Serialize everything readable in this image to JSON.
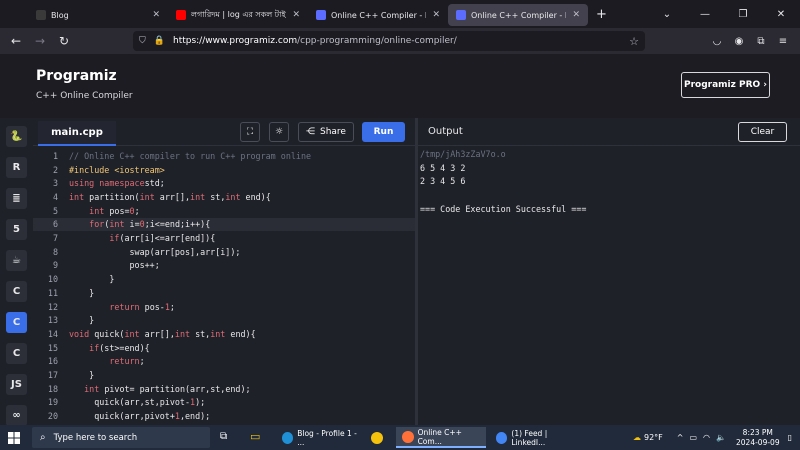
{
  "browser": {
    "tabs": [
      {
        "title": "Blog",
        "active": false,
        "color": "#3a3a3a"
      },
      {
        "title": "লগারিদম | log এর সকল টাইপের",
        "active": false,
        "color": "#ff0000"
      },
      {
        "title": "Online C++ Compiler - Program",
        "active": false,
        "color": "#5b6cff"
      },
      {
        "title": "Online C++ Compiler - Program",
        "active": true,
        "color": "#5b6cff"
      }
    ],
    "new_tab": "+",
    "url_host": "https://www.programiz.com",
    "url_path": "/cpp-programming/online-compiler/"
  },
  "site": {
    "logo": "Programiz",
    "subtitle": "C++ Online Compiler",
    "pro_button": "Programiz PRO ›"
  },
  "rail": {
    "items": [
      {
        "name": "python",
        "glyph": "🐍"
      },
      {
        "name": "r",
        "glyph": "R"
      },
      {
        "name": "sql",
        "glyph": "≣"
      },
      {
        "name": "html",
        "glyph": "5"
      },
      {
        "name": "java",
        "glyph": "☕"
      },
      {
        "name": "c",
        "glyph": "C"
      },
      {
        "name": "cpp",
        "glyph": "C"
      },
      {
        "name": "csharp",
        "glyph": "C"
      },
      {
        "name": "js",
        "glyph": "JS"
      },
      {
        "name": "go",
        "glyph": "∞"
      }
    ],
    "active_index": 6
  },
  "editor": {
    "file_tab": "main.cpp",
    "share_label": "Share",
    "run_label": "Run",
    "highlight_line": 6,
    "lines": [
      [
        [
          "c-com",
          "// Online C++ compiler to run C++ program online"
        ]
      ],
      [
        [
          "c-pre",
          "#include <iostream>"
        ]
      ],
      [
        [
          "c-kw",
          "using namespace"
        ],
        [
          "",
          "std;"
        ]
      ],
      [
        [
          "c-kw",
          "int"
        ],
        [
          "",
          " partition("
        ],
        [
          "c-kw",
          "int"
        ],
        [
          "",
          " arr[],"
        ],
        [
          "c-kw",
          "int"
        ],
        [
          "",
          " st,"
        ],
        [
          "c-kw",
          "int"
        ],
        [
          "",
          " end){"
        ]
      ],
      [
        [
          "",
          "    "
        ],
        [
          "c-kw",
          "int"
        ],
        [
          "",
          " pos="
        ],
        [
          "c-num",
          "0"
        ],
        [
          "",
          ";"
        ]
      ],
      [
        [
          "",
          "    "
        ],
        [
          "c-kw",
          "for"
        ],
        [
          "",
          "("
        ],
        [
          "c-kw",
          "int"
        ],
        [
          "",
          " i="
        ],
        [
          "c-num",
          "0"
        ],
        [
          "",
          ";i<=end;i++){"
        ]
      ],
      [
        [
          "",
          "        "
        ],
        [
          "c-kw",
          "if"
        ],
        [
          "",
          "(arr[i]<=arr[end]){"
        ]
      ],
      [
        [
          "",
          "            swap(arr[pos],arr[i]);"
        ]
      ],
      [
        [
          "",
          "            pos++;"
        ]
      ],
      [
        [
          "",
          "        }"
        ]
      ],
      [
        [
          "",
          "    }"
        ]
      ],
      [
        [
          "",
          "        "
        ],
        [
          "c-kw",
          "return"
        ],
        [
          "",
          " pos-"
        ],
        [
          "c-num",
          "1"
        ],
        [
          "",
          ";"
        ]
      ],
      [
        [
          "",
          "    }"
        ]
      ],
      [
        [
          "c-kw",
          "void"
        ],
        [
          "",
          " quick("
        ],
        [
          "c-kw",
          "int"
        ],
        [
          "",
          " arr[],"
        ],
        [
          "c-kw",
          "int"
        ],
        [
          "",
          " st,"
        ],
        [
          "c-kw",
          "int"
        ],
        [
          "",
          " end){"
        ]
      ],
      [
        [
          "",
          "    "
        ],
        [
          "c-kw",
          "if"
        ],
        [
          "",
          "(st>=end){"
        ]
      ],
      [
        [
          "",
          "        "
        ],
        [
          "c-kw",
          "return"
        ],
        [
          "",
          ";"
        ]
      ],
      [
        [
          "",
          "    }"
        ]
      ],
      [
        [
          "",
          "   "
        ],
        [
          "c-kw",
          "int"
        ],
        [
          "",
          " pivot= partition(arr,st,end);"
        ]
      ],
      [
        [
          "",
          "     quick(arr,st,pivot-"
        ],
        [
          "c-num",
          "1"
        ],
        [
          "",
          ");"
        ]
      ],
      [
        [
          "",
          "     quick(arr,pivot+"
        ],
        [
          "c-num",
          "1"
        ],
        [
          "",
          ",end);"
        ]
      ]
    ]
  },
  "output": {
    "title": "Output",
    "clear_label": "Clear",
    "lines": [
      "/tmp/jAh3zZaV7o.o",
      "6 5 4 3 2",
      "2 3 4 5 6",
      "",
      "=== Code Execution Successful ==="
    ]
  },
  "taskbar": {
    "search_placeholder": "Type here to search",
    "apps": [
      {
        "label": "Blog - Profile 1 - ...",
        "color": "#1f8fd6",
        "active": false
      },
      {
        "label": "",
        "color": "#f4c20d",
        "active": false
      },
      {
        "label": "Online C++ Com...",
        "color": "#ff7139",
        "active": true
      },
      {
        "label": "(1) Feed | LinkedI...",
        "color": "#4285f4",
        "active": false
      }
    ],
    "weather": "92°F",
    "time": "8:23 PM",
    "date": "2024-09-09"
  }
}
